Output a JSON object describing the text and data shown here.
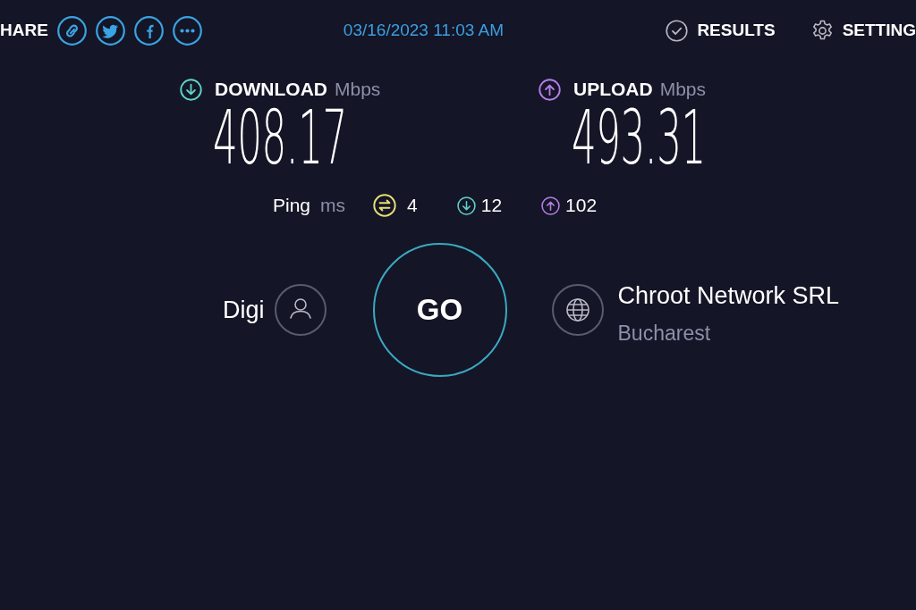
{
  "header": {
    "share_label": "HARE",
    "timestamp": "03/16/2023 11:03 AM",
    "nav": [
      {
        "kind": "results",
        "label": "RESULTS"
      },
      {
        "kind": "settings",
        "label": "SETTING"
      }
    ]
  },
  "speeds": [
    {
      "kind": "download",
      "label": "DOWNLOAD",
      "unit": "Mbps",
      "value": "408.17"
    },
    {
      "kind": "upload",
      "label": "UPLOAD",
      "unit": "Mbps",
      "value": "493.31"
    }
  ],
  "ping": {
    "label": "Ping",
    "unit": "ms",
    "readings": [
      {
        "kind": "idle",
        "value": "4"
      },
      {
        "kind": "download",
        "value": "12"
      },
      {
        "kind": "upload",
        "value": "102"
      }
    ]
  },
  "provider": {
    "name": "Digi"
  },
  "go_button": {
    "label": "GO"
  },
  "server": {
    "name": "Chroot Network SRL",
    "location": "Bucharest"
  }
}
